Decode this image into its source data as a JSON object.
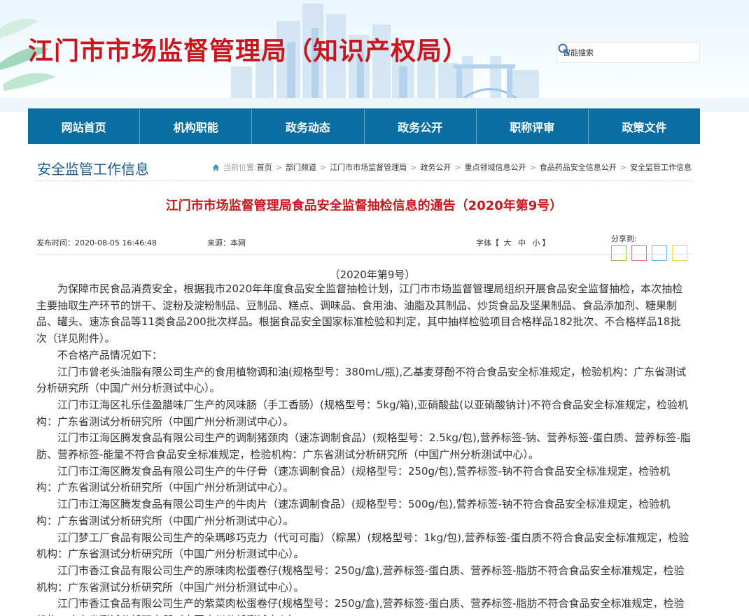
{
  "header": {
    "site_title": "江门市市场监督管理局（知识产权局）",
    "search_placeholder": "智能搜索"
  },
  "nav": {
    "items": [
      "网站首页",
      "机构职能",
      "政务动态",
      "政务公开",
      "职称评审",
      "政策文件"
    ]
  },
  "section_title": "安全监管工作信息",
  "breadcrumb": {
    "prefix": "当前位置:",
    "items": [
      "首页",
      "部门频道",
      "江门市市场监督管理局",
      "政务公开",
      "重点领域信息公开",
      "食品药品安全信息公开",
      "安全监管工作信息"
    ]
  },
  "article": {
    "title": "江门市市场监督管理局食品安全监督抽检信息的通告（2020年第9号）",
    "publish_time": "发布时间：2020-08-05 16:46:48",
    "source": "来源：本网",
    "font_label": "字体",
    "font_open": "【",
    "font_close": "】",
    "font_sizes": [
      "大",
      "中",
      "小"
    ],
    "share_label": "分享到:",
    "issue": "（2020年第9号）",
    "paragraphs": [
      "为保障市民食品消费安全，根据我市2020年年度食品安全监督抽检计划，江门市市场监督管理局组织开展食品安全监督抽检，本次抽检主要抽取生产环节的饼干、淀粉及淀粉制品、豆制品、糕点、调味品、食用油、油脂及其制品、炒货食品及坚果制品、食品添加剂、糖果制品、罐头、速冻食品等11类食品200批次样品。根据食品安全国家标准检验和判定，其中抽样检验项目合格样品182批次、不合格样品18批次（详见附件）。",
      "不合格产品情况如下：",
      "江门市曾老头油脂有限公司生产的食用植物调和油(规格型号：380mL/瓶),乙基麦芽酚不符合食品安全标准规定，检验机构：广东省测试分析研究所（中国广州分析测试中心）。",
      "江门市江海区礼乐佳盈腊味厂生产的风味肠（手工香肠）(规格型号：5kg/箱),亚硝酸盐(以亚硝酸钠计)不符合食品安全标准规定，检验机构：广东省测试分析研究所（中国广州分析测试中心）。",
      "江门市江海区腾发食品有限公司生产的调制猪颈肉（速冻调制食品）(规格型号：2.5kg/包),营养标签-钠、营养标签-蛋白质、营养标签-脂肪、营养标签-能量不符合食品安全标准规定，检验机构：广东省测试分析研究所（中国广州分析测试中心）。",
      "江门市江海区腾发食品有限公司生产的牛仔骨（速冻调制食品）(规格型号：250g/包),营养标签-钠不符合食品安全标准规定，检验机构：广东省测试分析研究所（中国广州分析测试中心）。",
      "江门市江海区腾发食品有限公司生产的牛肉片（速冻调制食品）(规格型号：500g/包),营养标签-钠不符合食品安全标准规定，检验机构：广东省测试分析研究所（中国广州分析测试中心）。",
      "江门梦工厂食品有限公司生产的朵瑪哆巧克力（代可可脂）（粽黑）(规格型号：1kg/包),营养标签-蛋白质不符合食品安全标准规定，检验机构：广东省测试分析研究所（中国广州分析测试中心）。",
      "江门市香江食品有限公司生产的原味肉松蛋卷仔(规格型号：250g/盒),营养标签-蛋白质、营养标签-脂肪不符合食品安全标准规定，检验机构：广东省测试分析研究所（中国广州分析测试中心）。",
      "江门市香江食品有限公司生产的紫菜肉松蛋卷仔(规格型号：250g/盒),营养标签-蛋白质、营养标签-脂肪不符合食品安全标准规定，检验机构：广东省测试分析研究所（中国广州分析测试中心）。"
    ]
  },
  "colors": {
    "brand_red": "#c9161d",
    "nav_blue": "#0a6ea3",
    "section_blue": "#1a5c8c",
    "share": [
      "#8bc34a",
      "#e57373",
      "#64b5f6",
      "#ffd54f"
    ]
  }
}
